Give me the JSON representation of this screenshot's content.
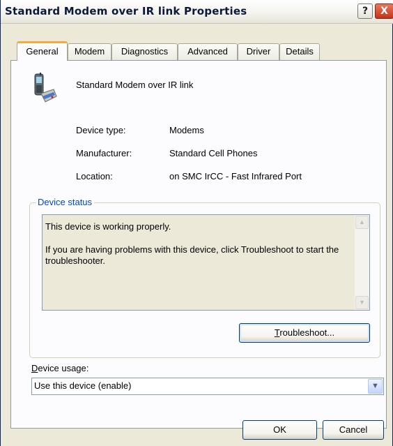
{
  "window": {
    "title": "Standard Modem over IR link Properties",
    "help_label": "?",
    "close_label": "X"
  },
  "tabs": [
    {
      "label": "General",
      "active": true
    },
    {
      "label": "Modem",
      "active": false
    },
    {
      "label": "Diagnostics",
      "active": false
    },
    {
      "label": "Advanced",
      "active": false
    },
    {
      "label": "Driver",
      "active": false
    },
    {
      "label": "Details",
      "active": false
    }
  ],
  "device": {
    "icon": "mobile-phone-modem-icon",
    "name": "Standard Modem over IR link",
    "properties": [
      {
        "label": "Device type:",
        "value": "Modems"
      },
      {
        "label": "Manufacturer:",
        "value": "Standard Cell Phones"
      },
      {
        "label": "Location:",
        "value": "on SMC IrCC - Fast Infrared Port"
      }
    ]
  },
  "status_group": {
    "title": "Device status",
    "line1": "This device is working properly.",
    "line2": "If you are having problems with this device, click Troubleshoot to start the troubleshooter.",
    "troubleshoot_accel": "T",
    "troubleshoot_rest": "roubleshoot..."
  },
  "usage": {
    "label_accel": "D",
    "label_rest": "evice usage:",
    "selected": "Use this device (enable)"
  },
  "footer": {
    "ok_label": "OK",
    "cancel_label": "Cancel"
  },
  "colors": {
    "dialog_face": "#ece9d8",
    "group_title": "#0046d5",
    "active_tab_accent": "#f6a93d",
    "button_border": "#003c74"
  }
}
